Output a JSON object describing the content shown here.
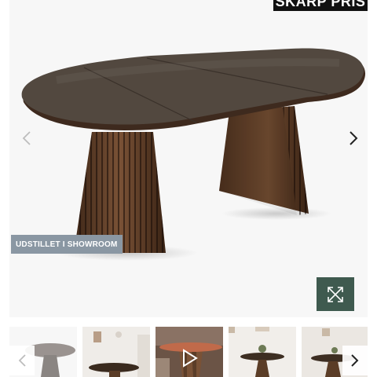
{
  "gallery": {
    "price_badge_text": "SKARP PRIS",
    "showroom_badge_text": "UDSTILLET I SHOWROOM",
    "main_image": "extendable-oval-dining-table-dark-wood-pedestal-bases",
    "icons": {
      "prev": "chevron-left-icon",
      "next": "chevron-right-icon",
      "zoom": "expand-icon",
      "video": "play-icon"
    },
    "colors": {
      "price_badge": "#111111",
      "showroom_badge": "#8a97a3",
      "zoom_button": "#3f5a4f",
      "wood": "#5b3d27"
    },
    "thumbnails": [
      {
        "name": "thumbnail-table-grey-top"
      },
      {
        "name": "thumbnail-table-room-scene"
      },
      {
        "name": "thumbnail-table-video",
        "is_video": true
      },
      {
        "name": "thumbnail-table-with-plant"
      },
      {
        "name": "thumbnail-table-kitchen-scene"
      }
    ]
  }
}
